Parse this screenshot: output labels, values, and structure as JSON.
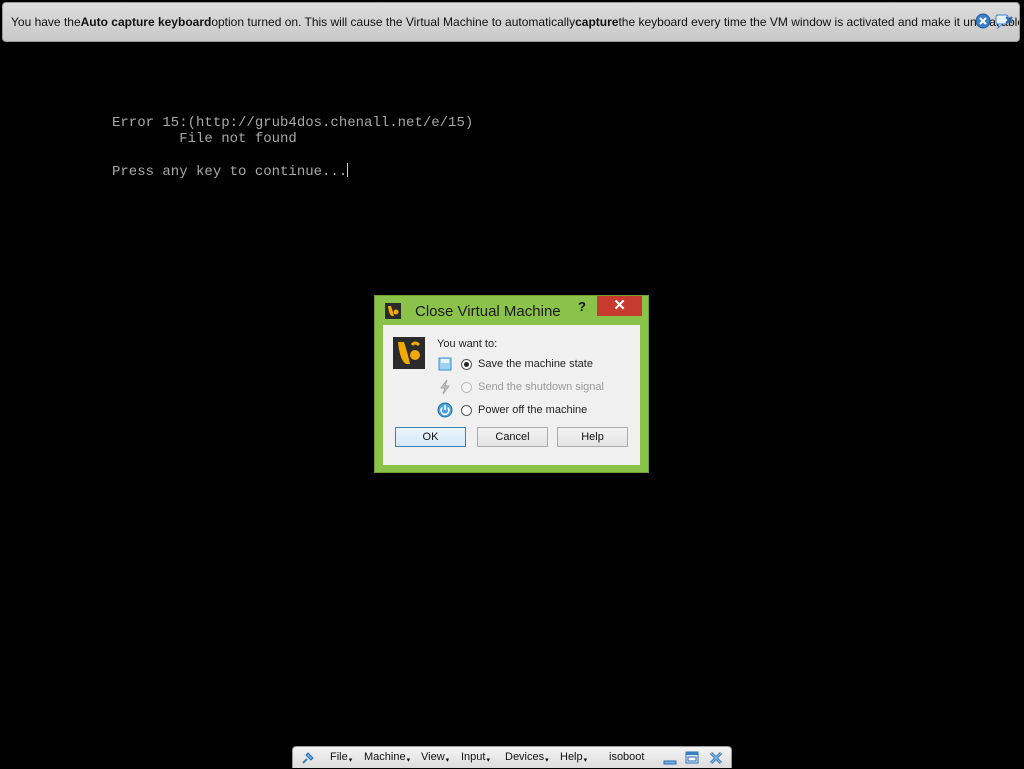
{
  "notification": {
    "text_1": "You have the ",
    "bold_1": "Auto capture keyboard",
    "text_2": " option turned on. This will cause the Virtual Machine to automatically ",
    "bold_2": "capture",
    "text_3": " the keyboard every time the VM window is activated and make it unavailable to",
    "close_icon": "close-icon",
    "dont_show_icon": "dont-show-again-icon"
  },
  "console": {
    "line_1": "Error 15:(http://grub4dos.chenall.net/e/15)",
    "line_2": "        File not found",
    "line_3": "Press any key to continue..."
  },
  "dialog": {
    "title": "Close Virtual Machine",
    "help_label": "?",
    "close_label": "✕",
    "prompt": "You want to:",
    "options": [
      {
        "label": "Save the machine state",
        "checked": true,
        "disabled": false,
        "icon": "save-state-icon"
      },
      {
        "label": "Send the shutdown signal",
        "checked": false,
        "disabled": true,
        "icon": "shutdown-signal-icon"
      },
      {
        "label": "Power off the machine",
        "checked": false,
        "disabled": false,
        "icon": "power-off-icon"
      }
    ],
    "buttons": {
      "ok": "OK",
      "cancel": "Cancel",
      "help": "Help"
    }
  },
  "minibar": {
    "menus": [
      "File",
      "Machine",
      "View",
      "Input",
      "Devices",
      "Help"
    ],
    "vm_name": "isoboot"
  },
  "colors": {
    "dialog_frame": "#8bc34a",
    "close_button": "#c73a2e",
    "console_text": "#a8a8a8"
  }
}
